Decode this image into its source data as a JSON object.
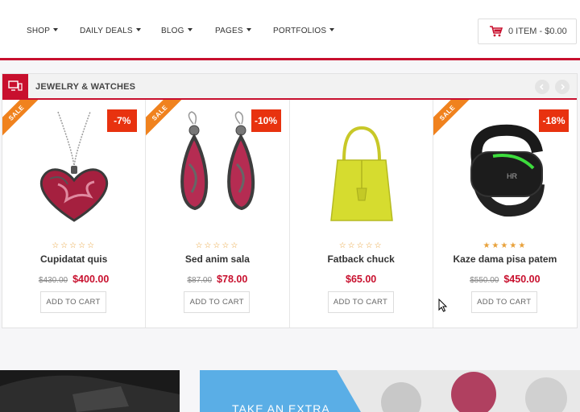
{
  "nav": {
    "items": [
      "SHOP",
      "DAILY DEALS",
      "BLOG",
      "PAGES",
      "PORTFOLIOS"
    ],
    "cart_label": "0 ITEM - $0.00"
  },
  "section": {
    "title": "JEWELRY & WATCHES",
    "icon": "devices-icon"
  },
  "colors": {
    "accent": "#c8102e",
    "sale": "#f0821e",
    "discount": "#e8320f",
    "star": "#e8a13a"
  },
  "products": [
    {
      "sale_label": "SALE",
      "discount": "-7%",
      "name": "Cupidatat quis",
      "old_price": "$430.00",
      "price": "$400.00",
      "rating": 0,
      "button": "ADD TO CART"
    },
    {
      "sale_label": "SALE",
      "discount": "-10%",
      "name": "Sed anim sala",
      "old_price": "$87.00",
      "price": "$78.00",
      "rating": 0,
      "button": "ADD TO CART"
    },
    {
      "sale_label": "",
      "discount": "",
      "name": "Fatback chuck",
      "old_price": "",
      "price": "$65.00",
      "rating": 0,
      "button": "ADD TO CART"
    },
    {
      "sale_label": "SALE",
      "discount": "-18%",
      "name": "Kaze dama pisa patem",
      "old_price": "$550.00",
      "price": "$450.00",
      "rating": 5,
      "button": "ADD TO CART"
    }
  ],
  "banner": {
    "text": "TAKE AN EXTRA"
  }
}
